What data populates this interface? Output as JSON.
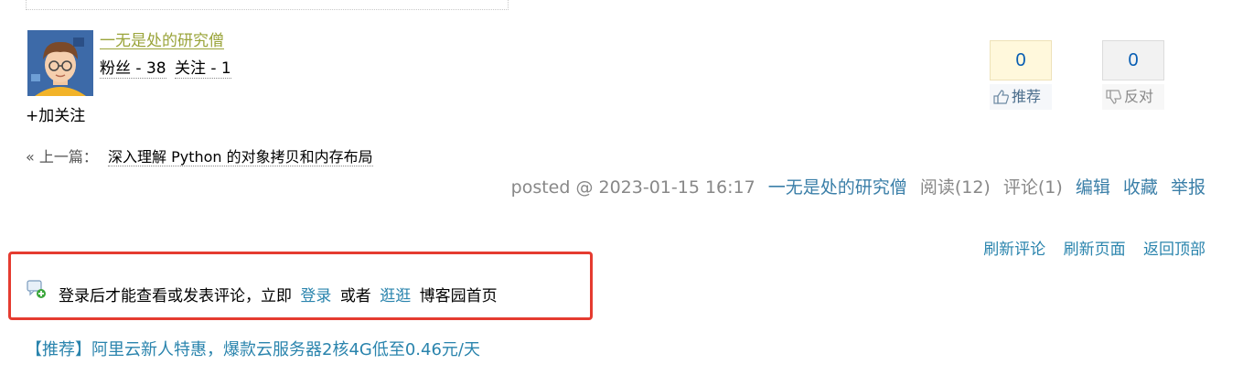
{
  "author": {
    "name": "一无是处的研究僧",
    "fans_label": "粉丝 - 38",
    "following_label": "关注 - 1",
    "follow_button": "+加关注"
  },
  "vote": {
    "digg_count": "0",
    "digg_label": "推荐",
    "bury_count": "0",
    "bury_label": "反对"
  },
  "prev_post": {
    "prefix": "« 上一篇：",
    "title": "深入理解 Python 的对象拷贝和内存布局"
  },
  "post_meta": {
    "posted": "posted @ 2023-01-15 16:17",
    "author": "一无是处的研究僧",
    "reads": "阅读(12)",
    "comments": "评论(1)",
    "edit": "编辑",
    "favorite": "收藏",
    "report": "举报"
  },
  "refresh": {
    "refresh_comments": "刷新评论",
    "refresh_page": "刷新页面",
    "back_to_top": "返回顶部"
  },
  "login_notice": {
    "before": "登录后才能查看或发表评论，立即",
    "login_link": "登录",
    "middle": "或者",
    "browse_link": "逛逛",
    "after": "博客园首页"
  },
  "ad": {
    "text": "【推荐】阿里云新人特惠，爆款云服务器2核4G低至0.46元/天"
  },
  "colors": {
    "link": "#2a84ad",
    "author_link": "#9aa43a",
    "highlight_border": "#e53b30",
    "digg_bg": "#fff8dc"
  }
}
